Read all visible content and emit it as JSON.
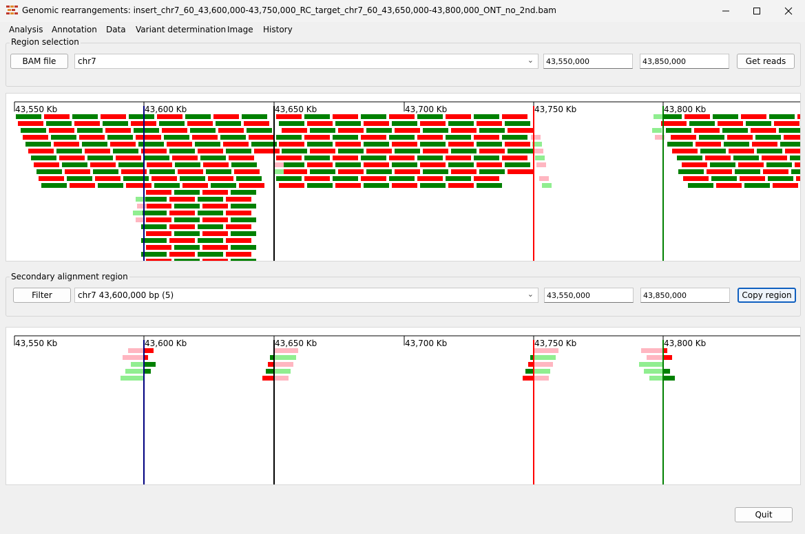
{
  "window": {
    "title": "Genomic rearrangements: insert_chr7_60_43,600,000-43,750,000_RC_target_chr7_60_43,650,000-43,800,000_ONT_no_2nd.bam",
    "minimize_icon": "minimize-icon",
    "maximize_icon": "maximize-icon",
    "close_icon": "close-icon"
  },
  "menu": [
    "Analysis",
    "Annotation",
    "Data",
    "Variant determination",
    "Image",
    "History"
  ],
  "region_selection": {
    "label": "Region selection",
    "bam_button": "BAM file",
    "chromosome": "chr7",
    "start": "43,550,000",
    "end": "43,850,000",
    "get_reads_button": "Get reads"
  },
  "secondary_region": {
    "label": "Secondary alignment region",
    "filter_button": "Filter",
    "selection": "chr7 43,600,000 bp (5)",
    "start": "43,550,000",
    "end": "43,850,000",
    "copy_region_button": "Copy region"
  },
  "quit_button": "Quit",
  "tick_labels": [
    "43,550 Kb",
    "43,600 Kb",
    "43,650 Kb",
    "43,700 Kb",
    "43,750 Kb",
    "43,800 Kb"
  ],
  "colors": {
    "forward_read": "#ff0000",
    "reverse_read": "#008000",
    "clipped_forward": "#ffb6c1",
    "clipped_reverse": "#90ee90",
    "insert_start_line": "#000080",
    "target_start_line": "#000000",
    "insert_end_line": "#ff0000",
    "target_end_line": "#008000"
  }
}
